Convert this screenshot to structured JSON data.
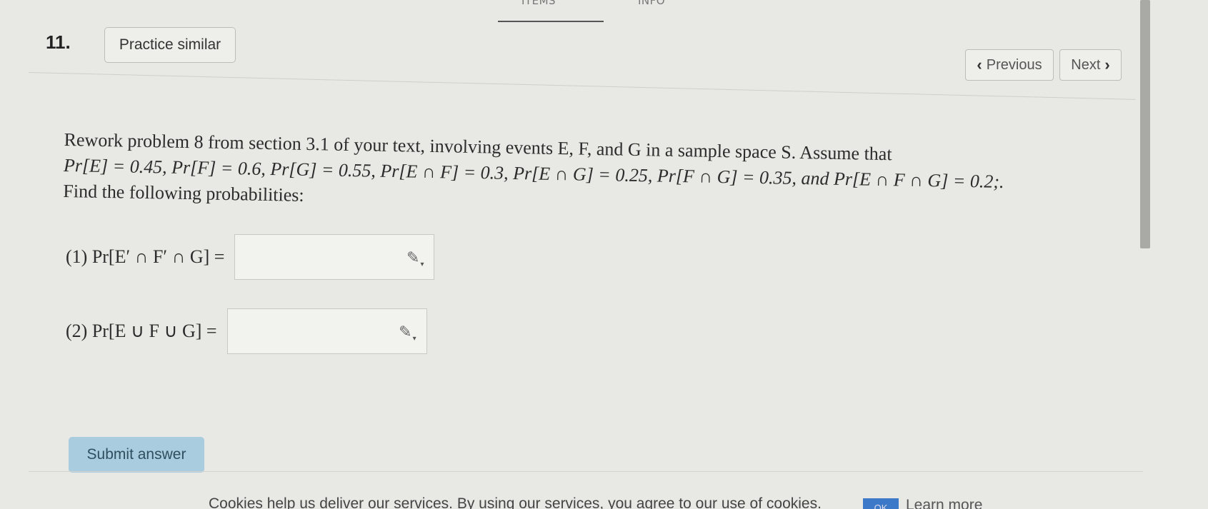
{
  "top_tabs": {
    "items": "ITEMS",
    "info": "INFO"
  },
  "header": {
    "question_number": "11.",
    "practice_label": "Practice similar",
    "previous_label": "Previous",
    "next_label": "Next"
  },
  "question": {
    "intro": "Rework problem 8 from section 3.1 of your text, involving events E, F, and G in a sample space S. Assume that",
    "givens": "Pr[E] = 0.45, Pr[F] = 0.6, Pr[G] = 0.55, Pr[E ∩ F] = 0.3, Pr[E ∩ G] = 0.25, Pr[F ∩ G] = 0.35, and Pr[E ∩ F ∩ G] = 0.2;.",
    "prompt": "Find the following probabilities:"
  },
  "answers": [
    {
      "label": "(1) Pr[E′ ∩ F′ ∩ G] =",
      "value": ""
    },
    {
      "label": "(2) Pr[E ∪ F ∪ G] =",
      "value": ""
    }
  ],
  "submit_label": "Submit answer",
  "cookie": {
    "text": "Cookies help us deliver our services. By using our services, you agree to our use of cookies.",
    "ok_label": "OK",
    "learn_more_label": "Learn more"
  },
  "icons": {
    "previous": "chevron-left-icon",
    "next": "chevron-right-icon",
    "answer_edit": "pencil-icon"
  }
}
